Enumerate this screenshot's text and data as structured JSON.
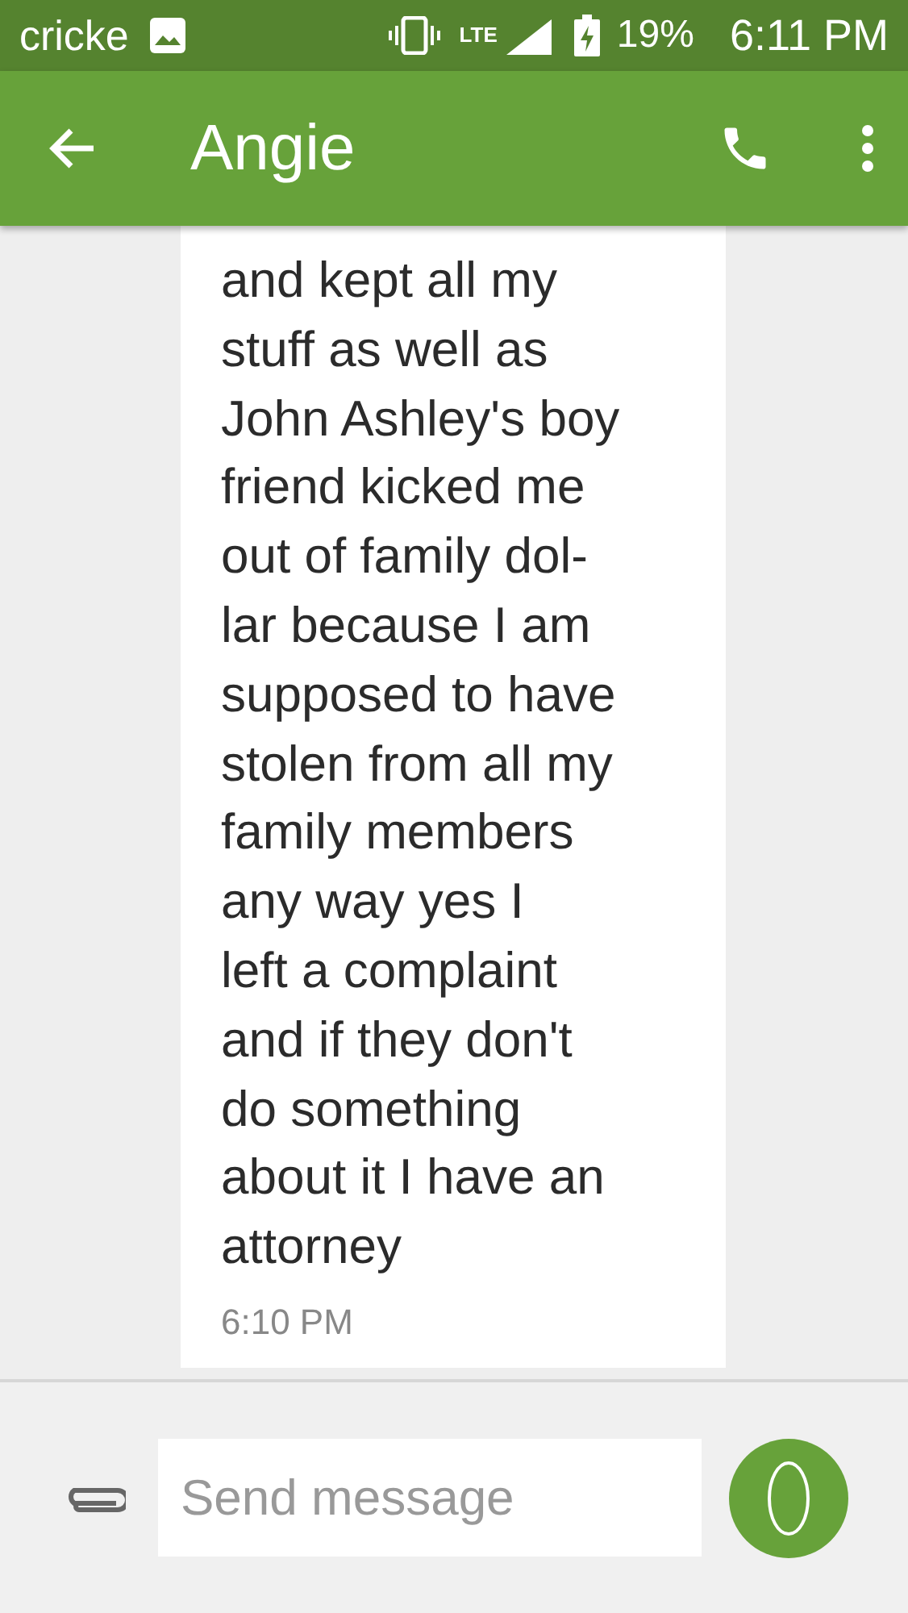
{
  "status_bar": {
    "carrier": "cricke",
    "network": "LTE",
    "battery": "19%",
    "time": "6:11 PM"
  },
  "header": {
    "title": "Angie"
  },
  "messages": [
    {
      "text": "and kept all my\nstuff as well as\nJohn Ashley's boy\nfriend kicked me\nout of family dol-\nlar because I am\nsupposed to have\nstolen from all my\nfamily members\nany way yes I\nleft a complaint\nand if they don't\ndo something\nabout it I have an\nattorney",
      "time": "6:10 PM"
    }
  ],
  "composer": {
    "placeholder": "Send message"
  }
}
